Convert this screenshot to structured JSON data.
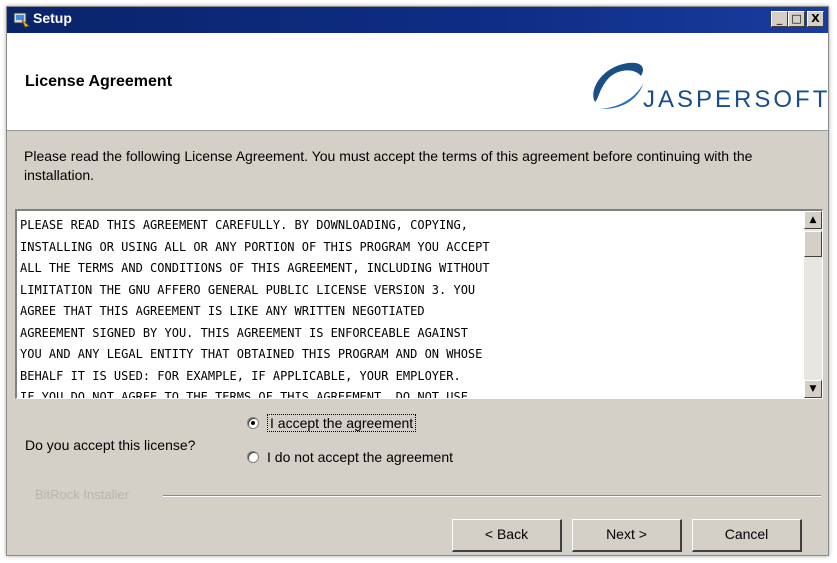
{
  "window": {
    "title": "Setup",
    "controls": {
      "minimize": "_",
      "maximize": "□",
      "close": "X"
    }
  },
  "header": {
    "page_title": "License Agreement",
    "logo_text": "JASPERSOFT"
  },
  "content": {
    "intro": "Please read the following License Agreement. You must accept the terms of this agreement before continuing with the installation.",
    "license_text": "PLEASE READ THIS AGREEMENT CAREFULLY. BY DOWNLOADING, COPYING,\nINSTALLING OR USING ALL OR ANY PORTION OF THIS PROGRAM YOU ACCEPT\nALL THE TERMS AND CONDITIONS OF THIS AGREEMENT, INCLUDING WITHOUT\nLIMITATION THE GNU AFFERO GENERAL PUBLIC LICENSE VERSION 3. YOU\nAGREE THAT THIS AGREEMENT IS LIKE ANY WRITTEN NEGOTIATED\nAGREEMENT SIGNED BY YOU. THIS AGREEMENT IS ENFORCEABLE AGAINST\nYOU AND ANY LEGAL ENTITY THAT OBTAINED THIS PROGRAM AND ON WHOSE\nBEHALF IT IS USED: FOR EXAMPLE, IF APPLICABLE, YOUR EMPLOYER.\nIF YOU DO NOT AGREE TO THE TERMS OF THIS AGREEMENT, DO NOT USE",
    "question": "Do you accept this license?",
    "options": [
      {
        "label": "I accept the agreement",
        "selected": true
      },
      {
        "label": "I do not accept the agreement",
        "selected": false
      }
    ]
  },
  "footer": {
    "installer_label": "BitRock Installer",
    "buttons": {
      "back": "< Back",
      "next": "Next >",
      "cancel": "Cancel"
    }
  },
  "icons": {
    "app": "setup-app-icon",
    "logo": "jaspersoft-swoosh-icon",
    "scroll_up": "arrow-up-icon",
    "scroll_down": "arrow-down-icon"
  },
  "colors": {
    "titlebar": "#0a246a",
    "face": "#d4d0c8",
    "logo": "#1a4e88"
  }
}
